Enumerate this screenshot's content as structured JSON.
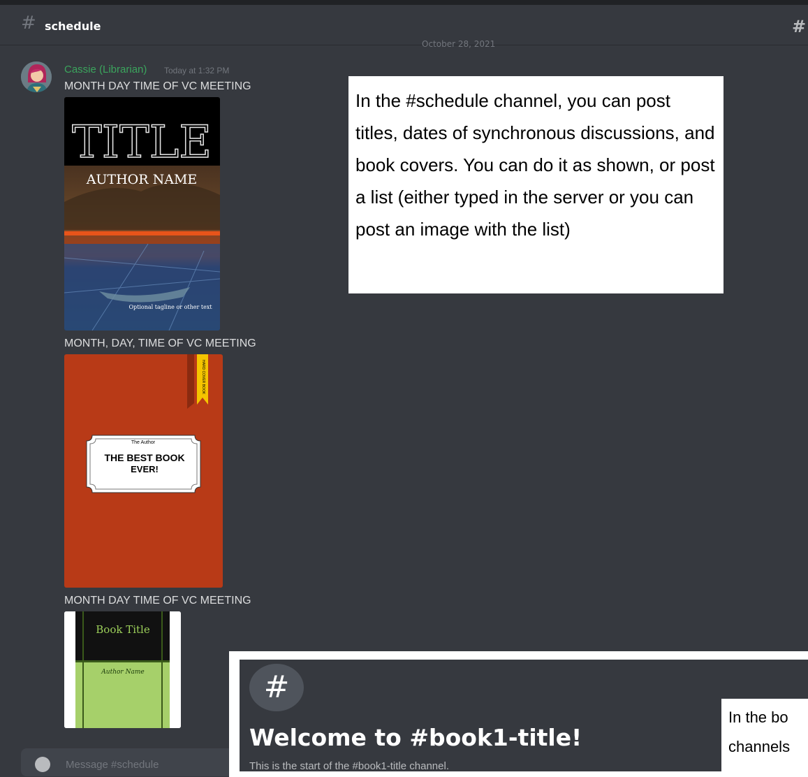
{
  "channel": {
    "name": "schedule",
    "hash_icon": "hashtag-icon",
    "right_icon": "threads-icon"
  },
  "date_divider": "October 28, 2021",
  "message": {
    "author": "Cassie (Librarian)",
    "author_color": "#3ba55d",
    "timestamp": "Today at 1:32 PM",
    "lines": [
      "MONTH DAY TIME OF VC MEETING",
      "MONTH, DAY, TIME OF VC MEETING",
      "MONTH DAY TIME OF VC MEETING"
    ]
  },
  "covers": [
    {
      "title": "TITLE",
      "author": "AUTHOR NAME",
      "tagline": "Optional tagline or other text"
    },
    {
      "author": "The Author",
      "title": "THE BEST BOOK EVER!",
      "ribbon": "HARD COVER BOOK"
    },
    {
      "title": "Book Title",
      "author": "Author Name"
    }
  ],
  "callout_schedule": "In the #schedule channel, you can post titles, dates of synchronous discussions, and book covers.  You can do it as shown, or post a list (either typed in the server or you can post an image with the list)",
  "input": {
    "placeholder": "Message #schedule"
  },
  "second_panel": {
    "icon": "#",
    "title": "Welcome to #book1-title!",
    "subtitle": "This is the start of the #book1-title channel."
  },
  "callout_book": {
    "line1": "In the bo",
    "line2": "channels"
  }
}
